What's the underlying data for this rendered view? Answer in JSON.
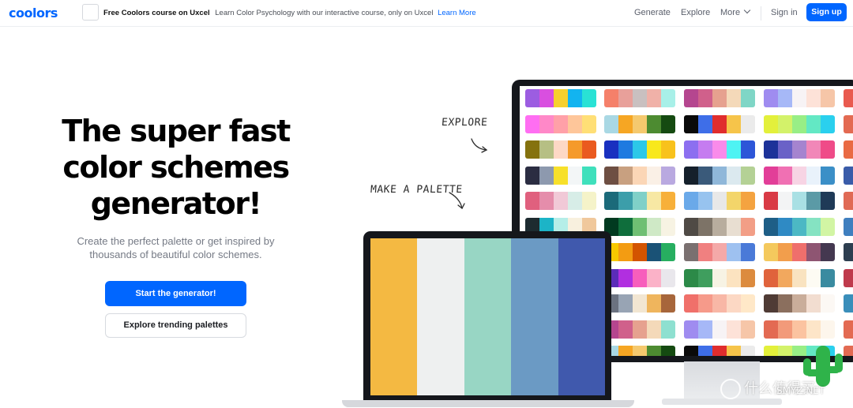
{
  "header": {
    "logo": "coolors",
    "promo": {
      "title": "Free Coolors course on Uxcel",
      "text": "Learn Color Psychology with our interactive course, only on Uxcel",
      "link": "Learn More"
    },
    "nav": {
      "generate": "Generate",
      "explore": "Explore",
      "more": "More",
      "sign_in": "Sign in",
      "sign_up": "Sign up"
    }
  },
  "hero": {
    "title_lines": [
      "The super fast",
      "color schemes",
      "generator!"
    ],
    "subtitle_lines": [
      "Create the perfect palette or get inspired by",
      "thousands of beautiful color schemes."
    ],
    "primary_button": "Start the generator!",
    "secondary_button": "Explore trending palettes"
  },
  "illustration": {
    "labels": {
      "explore": "EXPLORE",
      "make_palette": "MAKE A PALETTE"
    },
    "laptop_palette": [
      "#f4b942",
      "#eef0f0",
      "#98d6c4",
      "#6b9ac4",
      "#4059ad"
    ],
    "monitor_palettes": [
      [
        [
          "#9c5de1",
          "#d94fe0",
          "#f7d02e",
          "#12b4f0",
          "#29e2d5"
        ],
        [
          "#f5806a",
          "#e8a09a",
          "#c9c0c0",
          "#f0b1a8",
          "#a8f0e8"
        ],
        [
          "#b5468f",
          "#d0608b",
          "#e6a18f",
          "#f4d9b9",
          "#7fd6c6"
        ],
        [
          "#9f8cf0",
          "#a6b8f7",
          "#f7f3f5",
          "#fde2d8",
          "#f6c6a8"
        ],
        [
          "#e95a4f"
        ]
      ],
      [
        [
          "#ff6ef2",
          "#ff88c8",
          "#ffa0a8",
          "#fec69a",
          "#ffdf76"
        ],
        [
          "#a9d8e4",
          "#f6a623",
          "#f5c96e",
          "#4d8b31",
          "#154a11"
        ],
        [
          "#0a0a0a",
          "#3e6ee8",
          "#e02d2d",
          "#f6c44a",
          "#ebebeb"
        ],
        [
          "#e3f03b",
          "#d3f26a",
          "#98ee86",
          "#63e8c4",
          "#2ad0ee"
        ],
        [
          "#e36a52"
        ]
      ],
      [
        [
          "#85720e",
          "#b6bf84",
          "#fdd8c5",
          "#f59a2a",
          "#ea5a1f"
        ],
        [
          "#1930c0",
          "#1e7ae0",
          "#2cc8e8",
          "#f8e81c",
          "#f8c21c"
        ],
        [
          "#8c6ff0",
          "#c57cf0",
          "#f98bea",
          "#4ef3f3",
          "#2d56d8"
        ],
        [
          "#1d3299",
          "#6a62c7",
          "#a584cf",
          "#f187b8",
          "#ef4b88"
        ],
        [
          "#e96a43"
        ]
      ],
      [
        [
          "#2b2d42",
          "#8d99ae",
          "#f7e02a",
          "#f3f6f7",
          "#3fe0bc"
        ],
        [
          "#6e4f43",
          "#c8a080",
          "#fbd6b6",
          "#faf0e6",
          "#b9a9e0"
        ],
        [
          "#15202b",
          "#3a5a7a",
          "#8fb7d9",
          "#dbe9ef",
          "#b4d195"
        ],
        [
          "#e23e98",
          "#f070b3",
          "#f7d4e4",
          "#e9f2fb",
          "#3b8fc7"
        ],
        [
          "#3a5ca9"
        ]
      ],
      [
        [
          "#e0607e",
          "#e58dab",
          "#f1c9d7",
          "#d7ede7",
          "#f5f3c9"
        ],
        [
          "#1b6a7a",
          "#3c9eaa",
          "#80d0c8",
          "#f7e8a4",
          "#f7b03a"
        ],
        [
          "#6aa9e9",
          "#97c3ef",
          "#e8e8e8",
          "#f3d56a",
          "#f4a340"
        ],
        [
          "#d93a45",
          "#f3f4f5",
          "#a9e0e4",
          "#5b9aa6",
          "#1f3a57"
        ],
        [
          "#e06a55"
        ]
      ],
      [
        [
          "#1d2b30",
          "#1cb4c7",
          "#b5eee8",
          "#f8f0de",
          "#f0c89c"
        ],
        [
          "#013a20",
          "#0f6e3c",
          "#6fbf73",
          "#cfe9c6",
          "#f7f3e3"
        ],
        [
          "#4f4a45",
          "#7d7367",
          "#b8ad9e",
          "#e8ded1",
          "#f29e86"
        ],
        [
          "#1e5e86",
          "#2f8ac4",
          "#4cb8c4",
          "#85e3c2",
          "#d2f5a4"
        ],
        [
          "#3f7fbf"
        ]
      ],
      [
        [
          "#2b2b2b",
          "#f81f1f",
          "#fd8a0c",
          "#ffd21f",
          "#3b9e2e"
        ],
        [
          "#f8c900",
          "#f39c12",
          "#d35400",
          "#1a5276",
          "#27ae60"
        ],
        [
          "#7a7070",
          "#f08080",
          "#f4a9a8",
          "#9ec1f0",
          "#4a7ad8"
        ],
        [
          "#f4c95d",
          "#f29e4c",
          "#ef6f6c",
          "#8e5572",
          "#443850"
        ],
        [
          "#2d3e50"
        ]
      ],
      [
        [
          "#27a3b1",
          "#f9f5ea",
          "#f79c2c",
          "#e8352c",
          "#e8352c"
        ],
        [
          "#5b2cb8",
          "#b12fe0",
          "#f75ebc",
          "#fbb2c8",
          "#e9e7ec"
        ],
        [
          "#2c8a48",
          "#3f9e5e",
          "#f7f3e4",
          "#fce3c0",
          "#dc8b3e"
        ],
        [
          "#e0633c",
          "#f2a85e",
          "#f9e3c0",
          "#fdfbf3",
          "#3a8ba0"
        ],
        [
          "#bf3a4c"
        ]
      ],
      [
        [
          "#5dc1c1",
          "#a9a0cd",
          "#e9c6e8",
          "#fdfdfd",
          "#dbc99a"
        ],
        [
          "#6b7280",
          "#98a4b4",
          "#f2e6d2",
          "#efb55d",
          "#a7663b"
        ],
        [
          "#f0706a",
          "#f69a8a",
          "#f8b7a6",
          "#fcd8c4",
          "#ffe8c8"
        ],
        [
          "#4f3b35",
          "#8b6f5e",
          "#c9ad9a",
          "#f2ddd0",
          "#fcf8f4"
        ],
        [
          "#3a8eba"
        ]
      ],
      [
        [
          "#d94b62",
          "#e8929c",
          "#dad2d2",
          "#fae4c6",
          "#9ff0e6"
        ],
        [
          "#b5468f",
          "#d0608b",
          "#e6a18f",
          "#f4d9b9",
          "#8ee0d0"
        ],
        [
          "#9f8cf0",
          "#a6b8f7",
          "#f7f3f5",
          "#fde2d8",
          "#f6c6a8"
        ],
        [
          "#e36a52",
          "#f29a7a",
          "#fbc3a0",
          "#fde5c8",
          "#fdf6ec"
        ],
        [
          "#e36a52"
        ]
      ],
      [
        [
          "#ff6ef2",
          "#ff88c8",
          "#ffa0a8",
          "#fec69a",
          "#ffdf76"
        ],
        [
          "#a9d8e4",
          "#f6a623",
          "#f5c96e",
          "#4d8b31",
          "#154a11"
        ],
        [
          "#0a0a0a",
          "#3e6ee8",
          "#e02d2d",
          "#f6c44a",
          "#ebebeb"
        ],
        [
          "#e3f03b",
          "#d3f26a",
          "#98ee86",
          "#63e8c4",
          "#2ad0ee"
        ],
        [
          "#e36a52"
        ]
      ]
    ]
  },
  "watermark": "什么值得买",
  "watermark_sub": "SMYZ.NET"
}
